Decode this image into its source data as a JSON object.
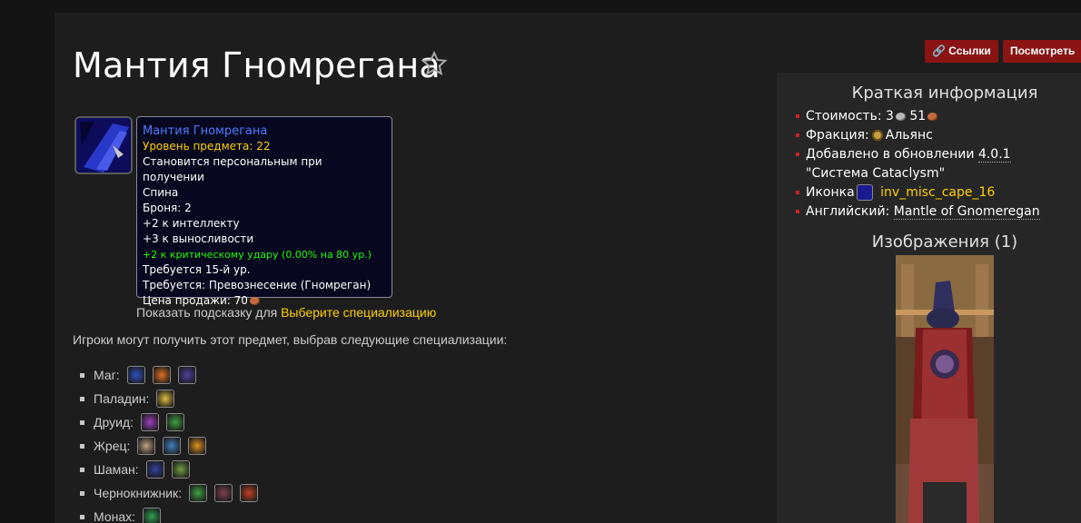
{
  "header": {
    "title": "Мантия Гномрегана",
    "btn_links": "Ссылки",
    "btn_view": "Посмотреть"
  },
  "tooltip": {
    "name": "Мантия Гномрегана",
    "item_level": "Уровень предмета: 22",
    "binding": "Становится персональным при получении",
    "slot": "Спина",
    "armor": "Броня: 2",
    "stat1": "+2 к интеллекту",
    "stat2": "+3 к выносливости",
    "stat3": "+2 к критическому удару (0.00% на 80 ур.)",
    "req_level": "Требуется 15-й ур.",
    "req_rep": "Требуется: Превознесение (Гномреган)",
    "sell_price_label": "Цена продажи: 70"
  },
  "hint": {
    "text": "Показать подсказку для",
    "link": "Выберите специализацию"
  },
  "intro": "Игроки могут получить этот предмет, выбрав следующие специализации:",
  "specs": [
    {
      "label": "Маг:",
      "icons": [
        "#3050c0",
        "#e07020",
        "#5040a0"
      ]
    },
    {
      "label": "Паладин:",
      "icons": [
        "#e0c040"
      ]
    },
    {
      "label": "Друид:",
      "icons": [
        "#a040c0",
        "#40a040"
      ]
    },
    {
      "label": "Жрец:",
      "icons": [
        "#c0a080",
        "#4080c0",
        "#e09020"
      ]
    },
    {
      "label": "Шаман:",
      "icons": [
        "#3040a0",
        "#70a040"
      ]
    },
    {
      "label": "Чернокнижник:",
      "icons": [
        "#40a040",
        "#804050",
        "#c04020"
      ]
    },
    {
      "label": "Монах:",
      "icons": [
        "#30a050"
      ]
    }
  ],
  "sidebar": {
    "title": "Краткая информация",
    "cost_label": "Стоимость: 3",
    "cost_silver": "51",
    "faction_label": "Фракция:",
    "faction_value": "Альянс",
    "added_label": "Добавлено в обновлении",
    "added_version": "4.0.1",
    "added_name": "\"Система Cataclysm\"",
    "icon_label": "Иконка",
    "icon_name": "inv_misc_cape_16",
    "english_label": "Английский:",
    "english_value": "Mantle of Gnomeregan",
    "images_title": "Изображения (1)"
  },
  "colors": {
    "accent_button": "#8a1414",
    "quality_rare": "#4f7bff",
    "item_level": "#ffd100",
    "bonus_green": "#1eff00"
  }
}
